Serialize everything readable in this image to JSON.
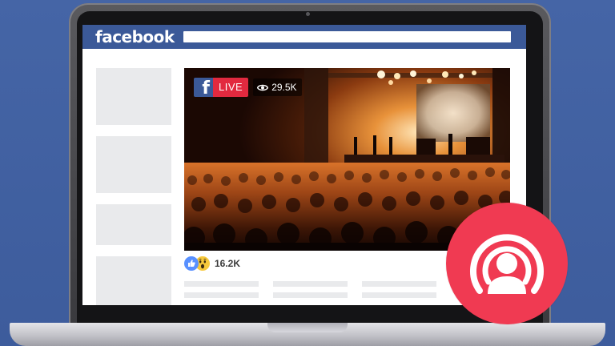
{
  "app": {
    "logo_text": "facebook"
  },
  "video": {
    "live_label": "LIVE",
    "fb_badge_glyph": "f",
    "viewers_count": "29.5K"
  },
  "reactions": {
    "count": "16.2K",
    "icons": [
      "like-icon",
      "wow-icon"
    ]
  },
  "colors": {
    "facebook_blue": "#3B5998",
    "background": "#4565A6",
    "live_red": "#E2293F",
    "live_circle": "#F03A52"
  }
}
